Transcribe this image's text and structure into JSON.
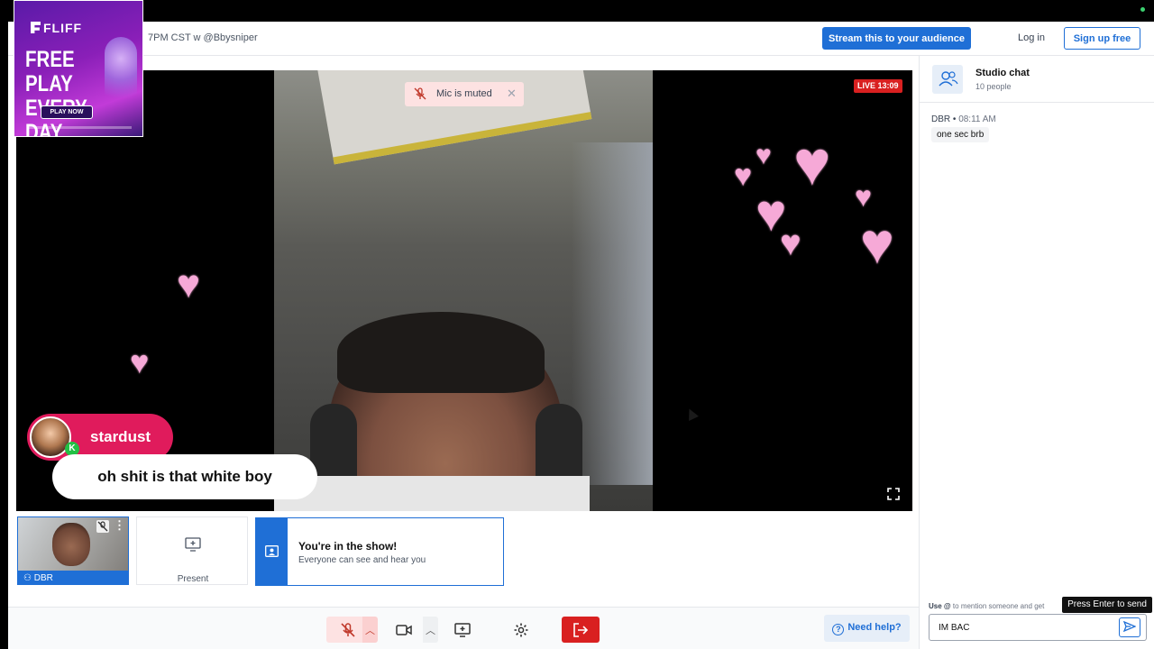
{
  "header": {
    "title": "7PM CST w @Bbysniper",
    "stream_button": "Stream this to your audience",
    "login": "Log in",
    "signup": "Sign up free"
  },
  "ad": {
    "brand": "FLIFF",
    "headline": "FREE PLAY EVERY DAY",
    "cta": "PLAY NOW"
  },
  "stage": {
    "toast": "Mic is muted",
    "live_badge": "LIVE 13:09",
    "overlay_name": "stardust",
    "overlay_badge": "K",
    "overlay_comment": "oh shit is that white boy"
  },
  "tiles": {
    "self_name": "DBR",
    "present_label": "Present",
    "show_title": "You're in the show!",
    "show_subtitle": "Everyone can see and hear you"
  },
  "controls": {
    "help": "Need help?"
  },
  "chat": {
    "title": "Studio chat",
    "count": "10 people",
    "messages": [
      {
        "author": "DBR",
        "time": "08:11 AM",
        "text": "one sec brb"
      }
    ],
    "hint_bold": "Use @",
    "hint": " to mention someone and get",
    "input_value": "IM BAC",
    "tooltip": "Press Enter to send"
  },
  "colors": {
    "accent": "#1f6fd6",
    "danger": "#d92020",
    "heart": "#f6a9d7",
    "overlay_pill": "#e01b5c"
  }
}
